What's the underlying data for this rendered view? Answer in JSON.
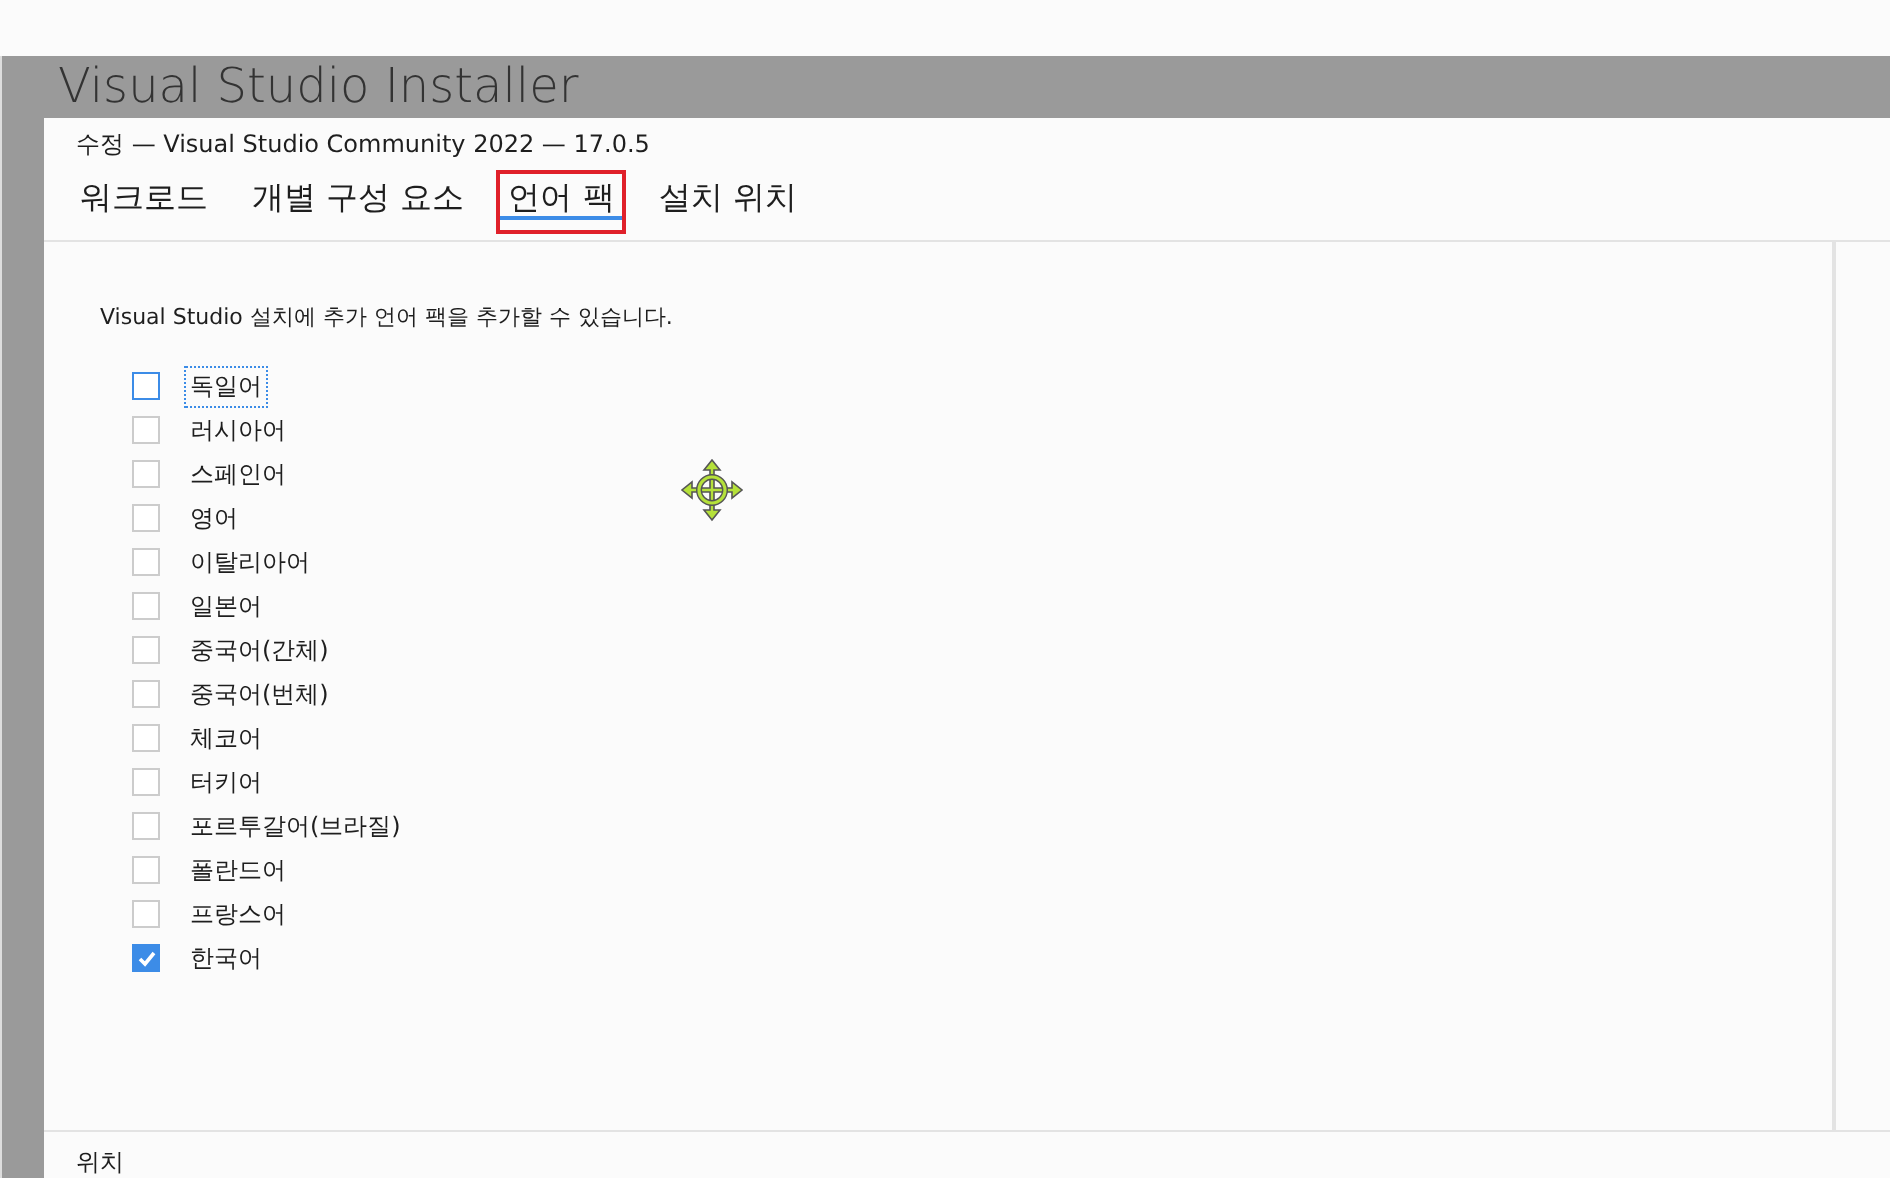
{
  "background_window": {
    "title": "Visual Studio Installer"
  },
  "dialog": {
    "title": "수정 — Visual Studio Community 2022 — 17.0.5",
    "tabs": [
      {
        "label": "워크로드",
        "selected": false,
        "highlighted": false
      },
      {
        "label": "개별 구성 요소",
        "selected": false,
        "highlighted": false
      },
      {
        "label": "언어 팩",
        "selected": true,
        "highlighted": true
      },
      {
        "label": "설치 위치",
        "selected": false,
        "highlighted": false
      }
    ],
    "description": "Visual Studio 설치에 추가 언어 팩을 추가할 수 있습니다.",
    "languages": [
      {
        "label": "독일어",
        "checked": false,
        "focused": true
      },
      {
        "label": "러시아어",
        "checked": false,
        "focused": false
      },
      {
        "label": "스페인어",
        "checked": false,
        "focused": false
      },
      {
        "label": "영어",
        "checked": false,
        "focused": false
      },
      {
        "label": "이탈리아어",
        "checked": false,
        "focused": false
      },
      {
        "label": "일본어",
        "checked": false,
        "focused": false
      },
      {
        "label": "중국어(간체)",
        "checked": false,
        "focused": false
      },
      {
        "label": "중국어(번체)",
        "checked": false,
        "focused": false
      },
      {
        "label": "체코어",
        "checked": false,
        "focused": false
      },
      {
        "label": "터키어",
        "checked": false,
        "focused": false
      },
      {
        "label": "포르투갈어(브라질)",
        "checked": false,
        "focused": false
      },
      {
        "label": "폴란드어",
        "checked": false,
        "focused": false
      },
      {
        "label": "프랑스어",
        "checked": false,
        "focused": false
      },
      {
        "label": "한국어",
        "checked": true,
        "focused": false
      }
    ],
    "footer_label": "위치"
  }
}
